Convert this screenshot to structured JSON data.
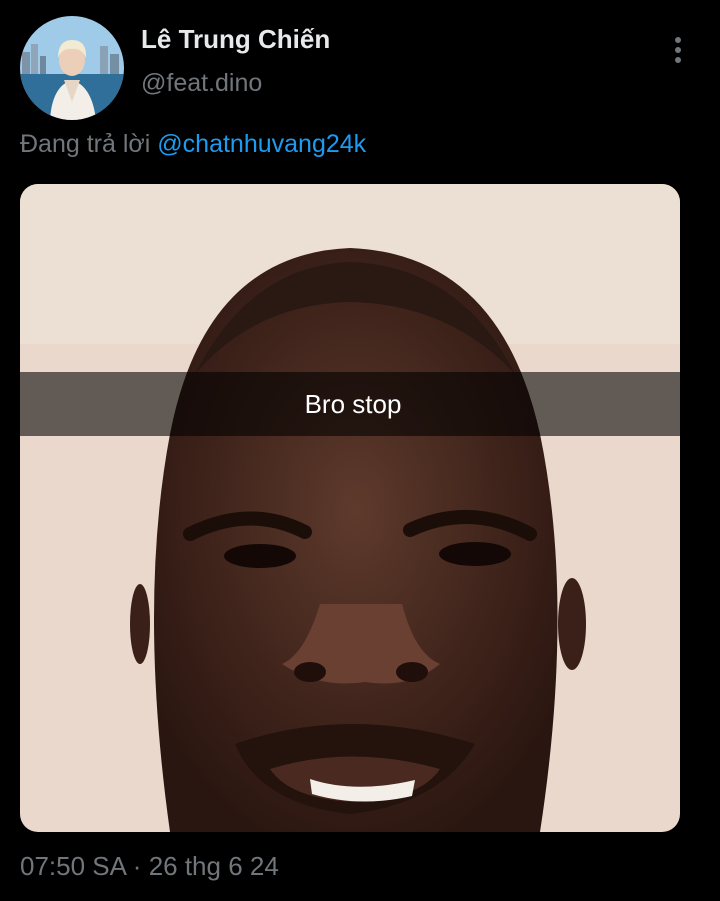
{
  "author": {
    "display_name": "Lê Trung Chiến",
    "handle": "@feat.dino"
  },
  "reply": {
    "prefix": "Đang trả lời",
    "mention": "@chatnhuvang24k"
  },
  "media": {
    "caption": "Bro stop"
  },
  "meta": {
    "time": "07:50 SA",
    "separator": "·",
    "date": "26 thg 6 24"
  },
  "icons": {
    "more": "more-vertical-icon"
  },
  "colors": {
    "background": "#000000",
    "primary_text": "#e7e9ea",
    "secondary_text": "#71767b",
    "link": "#1d9bf0"
  }
}
